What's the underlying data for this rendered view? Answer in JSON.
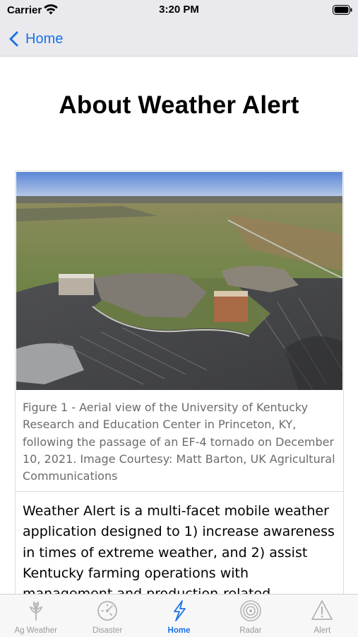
{
  "status_bar": {
    "carrier": "Carrier",
    "time": "3:20 PM"
  },
  "nav": {
    "back_label": "Home"
  },
  "page": {
    "title": "About Weather Alert",
    "caption": "Figure 1 - Aerial view of the University of Kentucky Research and Education Center in Princeton, KY, following the passage of an EF-4 tornado on December 10, 2021. Image Courtesy: Matt Barton, UK Agricultural Communications",
    "body": "Weather Alert is a multi-facet mobile weather application designed to 1) increase awareness in times of extreme weather, and 2) assist Kentucky farming operations with management and production-related decisions. Established"
  },
  "tabs": [
    {
      "label": "Ag Weather",
      "icon": "wheat-icon",
      "active": false
    },
    {
      "label": "Disaster",
      "icon": "gauge-icon",
      "active": false
    },
    {
      "label": "Home",
      "icon": "lightning-icon",
      "active": true
    },
    {
      "label": "Radar",
      "icon": "radar-icon",
      "active": false
    },
    {
      "label": "Alert",
      "icon": "warning-icon",
      "active": false
    }
  ],
  "colors": {
    "accent": "#1a73e8",
    "bar_background": "#e9e9ee",
    "caption_text": "#6b6b6b",
    "inactive_tab": "#9a9a9a"
  }
}
